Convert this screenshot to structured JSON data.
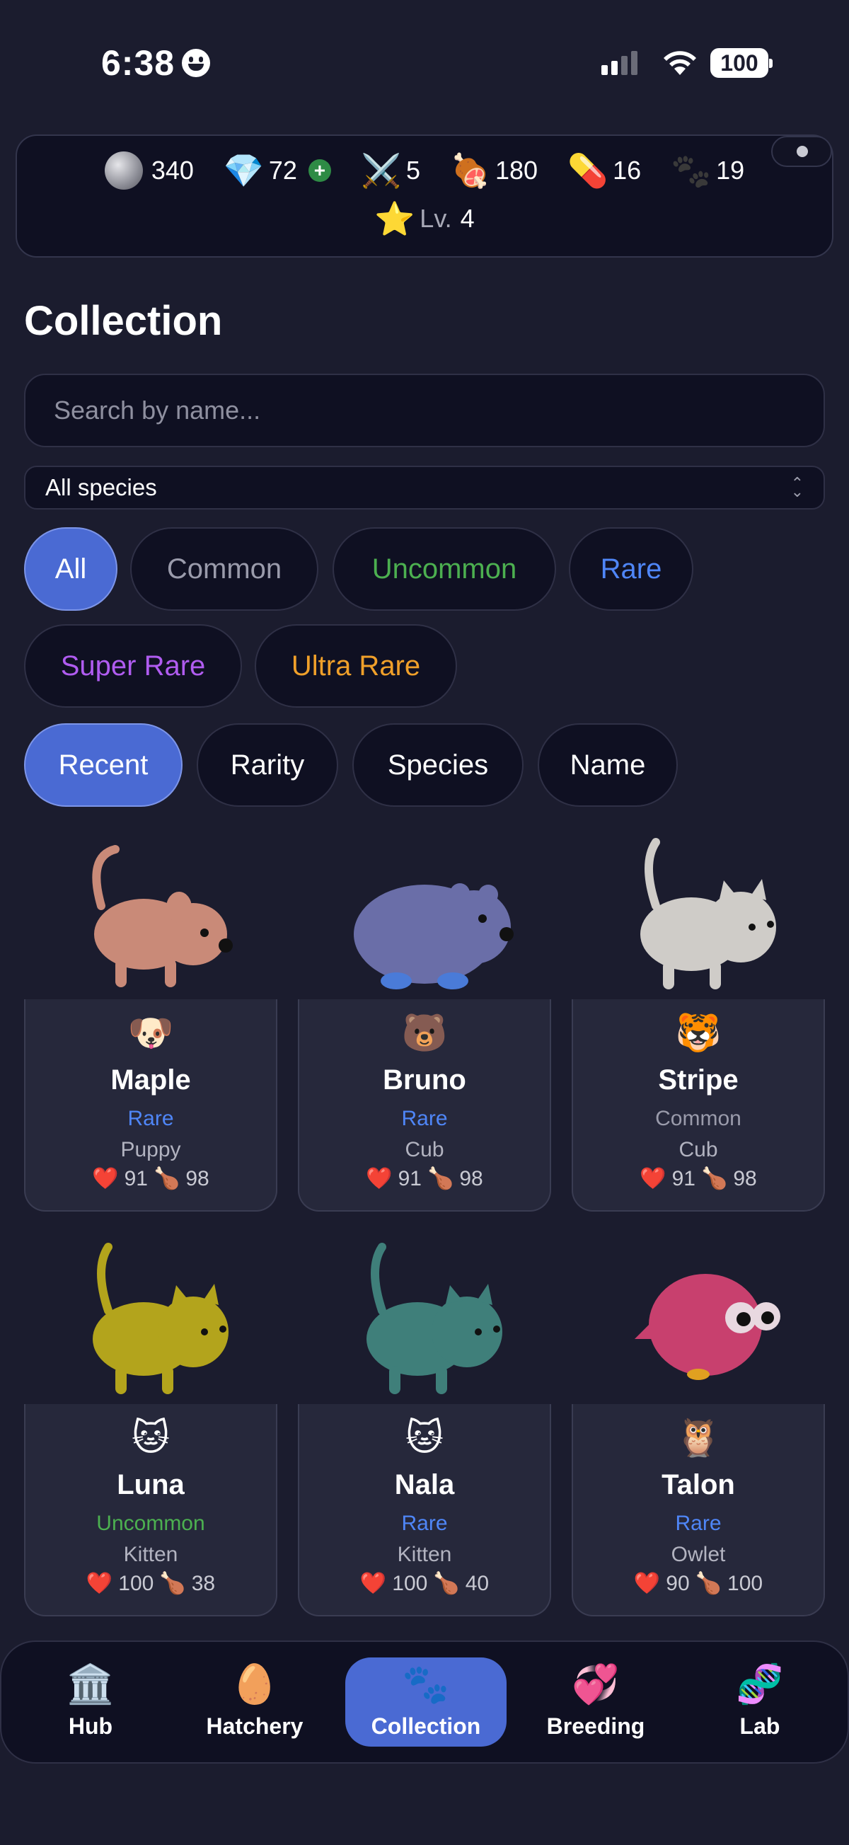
{
  "status": {
    "time": "6:38",
    "battery": "100"
  },
  "resources": [
    {
      "icon": "silver-coin-icon",
      "value": "340"
    },
    {
      "icon": "gem-icon",
      "glyph": "💎",
      "value": "72"
    },
    {
      "icon": "crossed-swords-icon",
      "glyph": "⚔️",
      "value": "5"
    },
    {
      "icon": "meat-icon",
      "glyph": "🍖",
      "value": "180"
    },
    {
      "icon": "pill-icon",
      "glyph": "💊",
      "value": "16"
    },
    {
      "icon": "paw-icon",
      "glyph": "🐾",
      "value": "19"
    }
  ],
  "level": {
    "icon": "star-icon",
    "glyph": "⭐",
    "label": "Lv.",
    "value": "4"
  },
  "page": {
    "title": "Collection"
  },
  "search": {
    "placeholder": "Search by name..."
  },
  "species_filter": {
    "selected": "All species"
  },
  "rarity_filters": [
    {
      "label": "All",
      "color": "#ffffff",
      "active": true
    },
    {
      "label": "Common",
      "color": "#9a9bab",
      "active": false
    },
    {
      "label": "Uncommon",
      "color": "#4cb050",
      "active": false
    },
    {
      "label": "Rare",
      "color": "#4f86f7",
      "active": false
    },
    {
      "label": "Super Rare",
      "color": "#b05cf0",
      "active": false
    },
    {
      "label": "Ultra Rare",
      "color": "#f0a02a",
      "active": false
    }
  ],
  "sort_options": [
    {
      "label": "Recent",
      "active": true
    },
    {
      "label": "Rarity",
      "active": false
    },
    {
      "label": "Species",
      "active": false
    },
    {
      "label": "Name",
      "active": false
    }
  ],
  "rarity_colors": {
    "Rare": "#4f86f7",
    "Common": "#9a9bab",
    "Uncommon": "#4cb050"
  },
  "pets": [
    {
      "emoji": "🐶",
      "name": "Maple",
      "rarity": "Rare",
      "species": "Puppy",
      "hp": "91",
      "food": "98",
      "model": "dog",
      "tint": "#c98a78"
    },
    {
      "emoji": "🐻",
      "name": "Bruno",
      "rarity": "Rare",
      "species": "Cub",
      "hp": "91",
      "food": "98",
      "model": "bear",
      "tint": "#6a6ea8"
    },
    {
      "emoji": "🐯",
      "name": "Stripe",
      "rarity": "Common",
      "species": "Cub",
      "hp": "91",
      "food": "98",
      "model": "cat",
      "tint": "#cfccc8"
    },
    {
      "emoji": "🐱",
      "name": "Luna",
      "rarity": "Uncommon",
      "species": "Kitten",
      "hp": "100",
      "food": "38",
      "model": "cat",
      "tint": "#b3a41c"
    },
    {
      "emoji": "🐱",
      "name": "Nala",
      "rarity": "Rare",
      "species": "Kitten",
      "hp": "100",
      "food": "40",
      "model": "cat",
      "tint": "#3f7f7a"
    },
    {
      "emoji": "🦉",
      "name": "Talon",
      "rarity": "Rare",
      "species": "Owlet",
      "hp": "90",
      "food": "100",
      "model": "owl",
      "tint": "#c8406e"
    }
  ],
  "stat_icons": {
    "hp": "❤️",
    "food": "🍗"
  },
  "nav": [
    {
      "icon": "museum-icon",
      "glyph": "🏛️",
      "label": "Hub",
      "active": false
    },
    {
      "icon": "egg-icon",
      "glyph": "🥚",
      "label": "Hatchery",
      "active": false
    },
    {
      "icon": "paw-icon",
      "glyph": "🐾",
      "label": "Collection",
      "active": true
    },
    {
      "icon": "hearts-icon",
      "glyph": "💞",
      "label": "Breeding",
      "active": false
    },
    {
      "icon": "dna-icon",
      "glyph": "🧬",
      "label": "Lab",
      "active": false
    }
  ]
}
